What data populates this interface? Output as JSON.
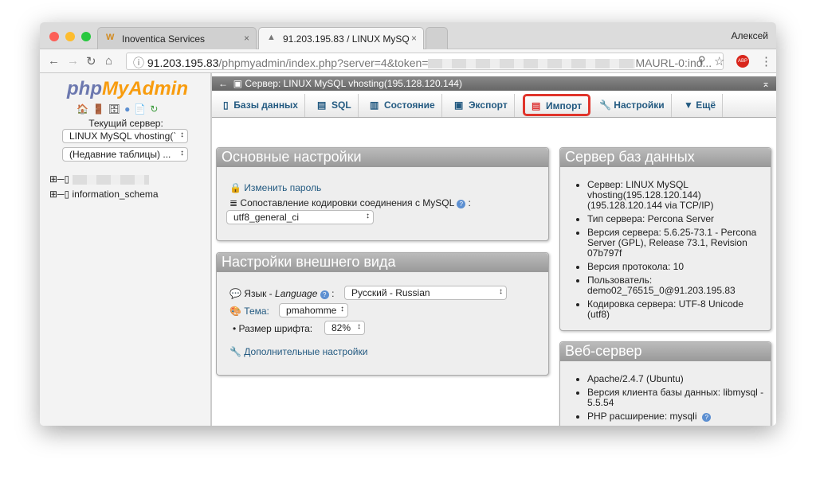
{
  "browser": {
    "tabs": [
      {
        "label": "Inoventica Services"
      },
      {
        "label": "91.203.195.83 / LINUX MySQ"
      }
    ],
    "user": "Алексей",
    "url": {
      "host": "91.203.195.83",
      "path": "/phpmyadmin/index.php?server=4&token=",
      "tail": "MAURL-0:ind..."
    }
  },
  "sidebar": {
    "logo_php": "php",
    "logo_myadmin": "MyAdmin",
    "current_server_label": "Текущий сервер:",
    "server_select": "LINUX MySQL vhosting(`",
    "recent_select": "(Недавние таблицы) ...",
    "databases": [
      "information_schema"
    ]
  },
  "main": {
    "server_bar": "Сервер: LINUX MySQL vhosting(195.128.120.144)",
    "tabs": [
      {
        "label": "Базы данных"
      },
      {
        "label": "SQL"
      },
      {
        "label": "Состояние"
      },
      {
        "label": "Экспорт"
      },
      {
        "label": "Импорт"
      },
      {
        "label": "Настройки"
      },
      {
        "label": "Ещё"
      }
    ],
    "general": {
      "title": "Основные настройки",
      "change_password": "Изменить пароль",
      "collation_label": "Сопоставление кодировки соединения с MySQL",
      "collation_value": "utf8_general_ci"
    },
    "appearance": {
      "title": "Настройки внешнего вида",
      "language_label": "Язык - ",
      "language_en": "Language",
      "language_value": "Русский - Russian",
      "theme_label": "Тема:",
      "theme_value": "pmahomme",
      "font_label": "Размер шрифта:",
      "font_value": "82%",
      "more_settings": "Дополнительные настройки"
    },
    "db_server": {
      "title": "Сервер баз данных",
      "items": [
        "Сервер: LINUX MySQL vhosting(195.128.120.144) (195.128.120.144 via TCP/IP)",
        "Тип сервера: Percona Server",
        "Версия сервера: 5.6.25-73.1 - Percona Server (GPL), Release 73.1, Revision 07b797f",
        "Версия протокола: 10",
        "Пользователь: demo02_76515_0@91.203.195.83",
        "Кодировка сервера: UTF-8 Unicode (utf8)"
      ]
    },
    "web_server": {
      "title": "Веб-сервер",
      "items": [
        "Apache/2.4.7 (Ubuntu)",
        "Версия клиента базы данных: libmysql - 5.5.54",
        "PHP расширение: mysqli"
      ]
    }
  }
}
